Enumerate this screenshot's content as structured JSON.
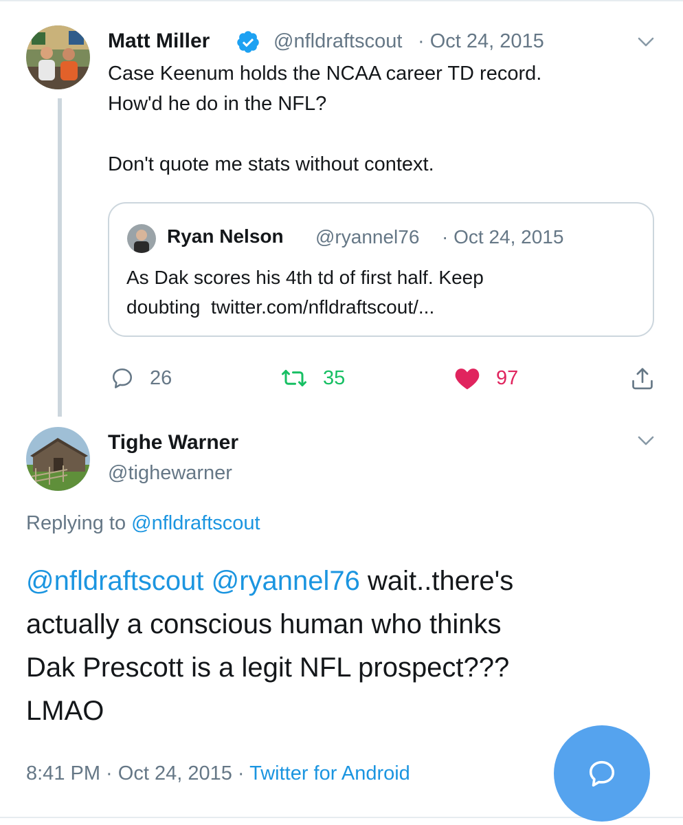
{
  "original_tweet": {
    "author_name": "Matt Miller",
    "handle": "@nfldraftscout",
    "date": "· Oct 24, 2015",
    "text": "Case Keenum holds the NCAA career TD record.\nHow'd he do in the NFL?\n\nDon't quote me stats without context.",
    "quoted_tweet": {
      "author_name": "Ryan Nelson",
      "handle": "@ryannel76",
      "date": "· Oct 24, 2015",
      "text": "As Dak scores his 4th td of first half. Keep\ndoubting  twitter.com/nfldraftscout/..."
    },
    "replies_count": "26",
    "retweets_count": "35",
    "likes_count": "97"
  },
  "reply_tweet": {
    "author_name": "Tighe Warner",
    "handle": "@tighewarner",
    "replying_to_label": "Replying to",
    "replying_to_handle": "@nfldraftscout",
    "mention_1": "@nfldraftscout",
    "mention_2": "@ryannel76",
    "text_1": " wait..there's",
    "text_2": "actually a conscious human who thinks",
    "text_3": "Dak Prescott is a legit NFL prospect???",
    "text_4": "LMAO",
    "time_date": "8:41 PM · Oct 24, 2015 ·",
    "source": "Twitter for Android"
  },
  "colors": {
    "verified_blue": "#1da1f2",
    "link_blue": "#1b95e0",
    "muted_gray": "#657786",
    "retweet_green": "#17bf63",
    "like_red": "#e0245e",
    "fab_blue": "#55a3ee"
  },
  "icons": [
    "verified-badge-icon",
    "chevron-down-icon",
    "reply-icon",
    "retweet-icon",
    "heart-icon",
    "share-icon",
    "compose-reply-icon"
  ]
}
